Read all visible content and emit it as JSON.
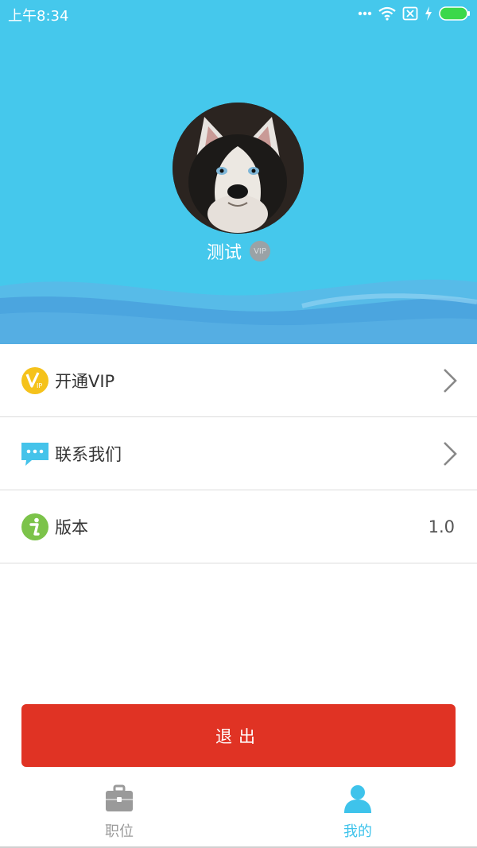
{
  "status_bar": {
    "time": "上午8:34",
    "icons": [
      "dots-icon",
      "wifi-icon",
      "sim-off-icon",
      "charging-icon",
      "battery-icon"
    ]
  },
  "profile": {
    "username": "测试",
    "vip_badge": "VIP"
  },
  "menu": {
    "items": [
      {
        "label": "开通VIP",
        "icon": "vip-icon",
        "value": ""
      },
      {
        "label": "联系我们",
        "icon": "chat-icon",
        "value": ""
      },
      {
        "label": "版本",
        "icon": "info-icon",
        "value": "1.0"
      }
    ]
  },
  "logout": {
    "label": "退出"
  },
  "tabs": [
    {
      "label": "职位",
      "icon": "briefcase-icon",
      "active": false
    },
    {
      "label": "我的",
      "icon": "person-icon",
      "active": true
    }
  ],
  "colors": {
    "header": "#45c8ec",
    "logout": "#e03324",
    "tab_active": "#3ec3eb",
    "tab_inactive": "#9a9a9a",
    "vip_icon": "#f5c21b",
    "chat_icon": "#45c3ea",
    "info_icon": "#7cc34a"
  }
}
